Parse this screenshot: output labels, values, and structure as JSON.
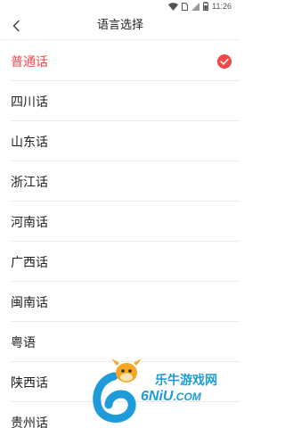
{
  "status_bar": {
    "time": "11:26",
    "icons": [
      "wifi-icon",
      "sim-icon",
      "signal-icon",
      "battery-icon"
    ]
  },
  "nav": {
    "title": "语言选择",
    "back_icon": "chevron-left-icon"
  },
  "languages": [
    {
      "label": "普通话",
      "selected": true
    },
    {
      "label": "四川话",
      "selected": false
    },
    {
      "label": "山东话",
      "selected": false
    },
    {
      "label": "浙江话",
      "selected": false
    },
    {
      "label": "河南话",
      "selected": false
    },
    {
      "label": "广西话",
      "selected": false
    },
    {
      "label": "闽南话",
      "selected": false
    },
    {
      "label": "粤语",
      "selected": false
    },
    {
      "label": "陕西话",
      "selected": false
    },
    {
      "label": "贵州话",
      "selected": false
    }
  ],
  "colors": {
    "accent": "#f04848",
    "text": "#222222",
    "divider": "#ececec",
    "watermark": "#1e9bd8",
    "watermark_orange": "#f5a623"
  },
  "watermark": {
    "cn_text": "乐牛游戏网",
    "en_text": "6NiU",
    "en_suffix": ".COM"
  }
}
